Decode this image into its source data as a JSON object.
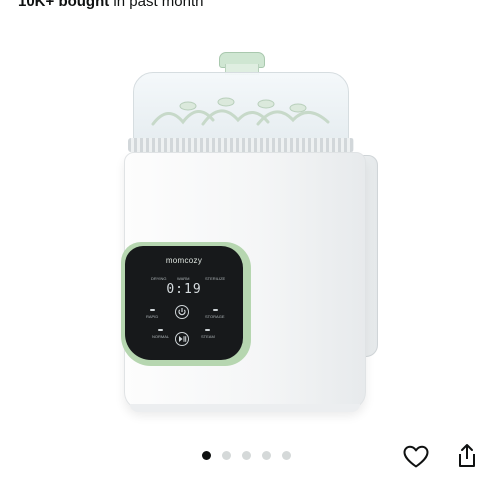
{
  "purchase_info": {
    "count": "10K+ bought",
    "suffix": " in past month"
  },
  "product": {
    "brand": "momcozy",
    "display_value": "0:19",
    "panel_labels": {
      "top_left": "DRYING",
      "top_mid": "WARM",
      "top_right": "STERILIZE",
      "rapid": "RAPID",
      "storage": "STORAGE",
      "normal": "NORMAL",
      "steam": "STEAM"
    },
    "colors": {
      "accent_green": "#b6d6b0",
      "panel_black": "#17191b"
    }
  },
  "gallery": {
    "image_count": 5,
    "active_index": 0
  },
  "actions": {
    "favorite_icon": "heart-icon",
    "share_icon": "share-icon"
  }
}
